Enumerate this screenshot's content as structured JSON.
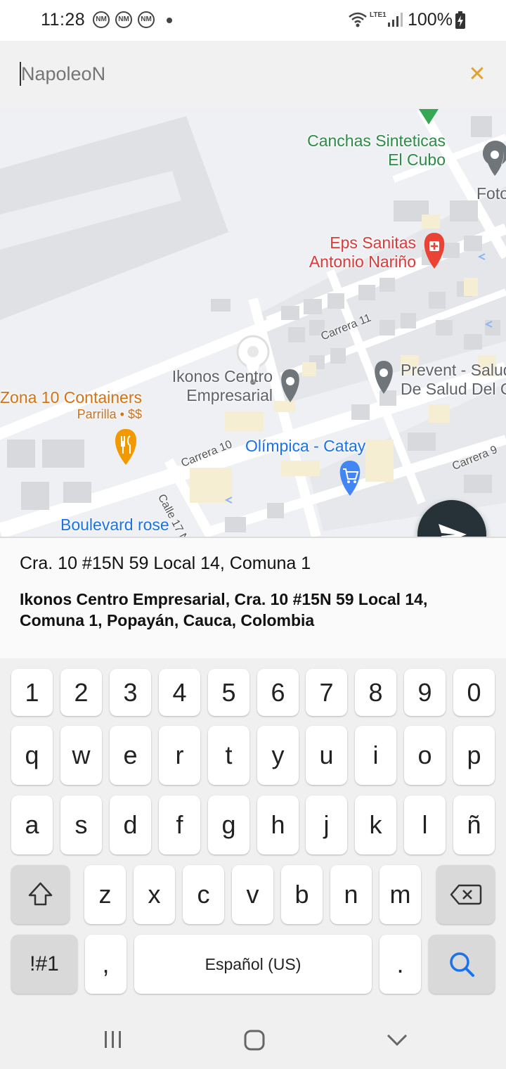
{
  "status_bar": {
    "time": "11:28",
    "notif_badges": [
      "NM",
      "NM",
      "NM"
    ],
    "battery": "100%",
    "network": "LTE1"
  },
  "search": {
    "value": "NapoleoN",
    "clear_label": "✕"
  },
  "map": {
    "places": [
      {
        "name": "Canchas Sinteticas",
        "name2": "El Cubo"
      },
      {
        "name": "Eps Sanitas",
        "name2": "Antonio Nariño"
      },
      {
        "name": "Ikonos Centro",
        "name2": "Empresarial"
      },
      {
        "name": "Prevent - Salud",
        "name2": "De Salud Del C"
      },
      {
        "name": "Zona 10 Containers",
        "name2": "Parrilla • $$"
      },
      {
        "name": "Olímpica - Catay"
      },
      {
        "name": "Boulevard rose"
      },
      {
        "name": "Foto"
      }
    ],
    "roads": [
      "Carrera 11",
      "Carrera 10",
      "Carrera 9",
      "Calle 17 N"
    ]
  },
  "result": {
    "short": "Cra. 10 #15N 59 Local 14, Comuna 1",
    "full": "Ikonos Centro Empresarial, Cra. 10 #15N 59 Local 14, Comuna 1, Popayán, Cauca, Colombia"
  },
  "keyboard": {
    "row_numbers": [
      "1",
      "2",
      "3",
      "4",
      "5",
      "6",
      "7",
      "8",
      "9",
      "0"
    ],
    "row_top": [
      "q",
      "w",
      "e",
      "r",
      "t",
      "y",
      "u",
      "i",
      "o",
      "p"
    ],
    "row_middle": [
      "a",
      "s",
      "d",
      "f",
      "g",
      "h",
      "j",
      "k",
      "l",
      "ñ"
    ],
    "row_bottom": [
      "z",
      "x",
      "c",
      "v",
      "b",
      "n",
      "m"
    ],
    "symbols_label": "!#1",
    "comma": ",",
    "space_label": "Español (US)",
    "period": "."
  },
  "colors": {
    "accent": "#e0a32b",
    "send_button": "#263238",
    "search_key": "#1a73e8"
  }
}
